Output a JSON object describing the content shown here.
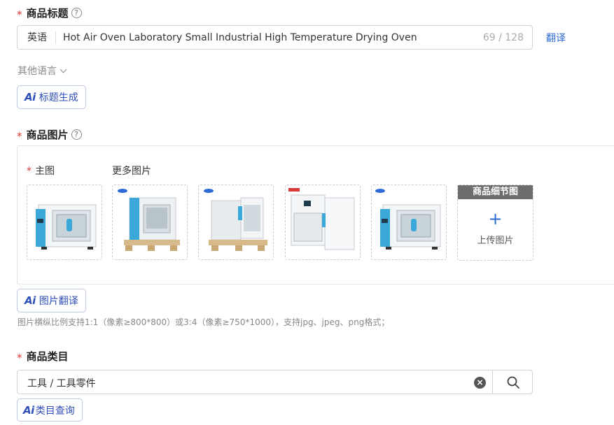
{
  "title_section": {
    "label": "商品标题",
    "help_icon": "question-circle-icon",
    "language": "英语",
    "value": "Hot Air Oven Laboratory Small Industrial High Temperature Drying Oven",
    "counter": "69 / 128",
    "translate_label": "翻译",
    "other_languages_label": "其他语言",
    "ai_button_label": "标题生成"
  },
  "image_section": {
    "label": "商品图片",
    "help_icon": "question-circle-icon",
    "main_image_label": "主图",
    "more_images_label": "更多图片",
    "detail_slot_title": "商品细节图",
    "upload_label": "上传图片",
    "ai_button_label": "图片翻译",
    "hint": "图片横纵比例支持1:1（像素≥800*800）或3:4（像素≥750*1000），支持jpg、jpeg、png格式；"
  },
  "category_section": {
    "label": "商品类目",
    "value": "工具 / 工具零件",
    "ai_button_label": "类目查询"
  },
  "ai_mark": "Ai",
  "colors": {
    "required": "#e53935",
    "link": "#2f6bd6",
    "ai_accent": "#2f4fb8",
    "oven_body": "#f2f4f6",
    "oven_accent": "#3aa8d8"
  }
}
